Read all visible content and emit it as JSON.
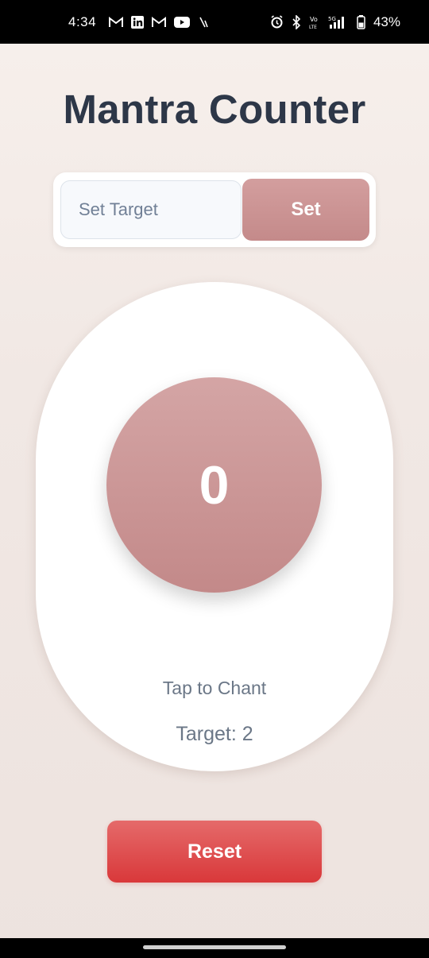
{
  "status_bar": {
    "time": "4:34",
    "battery": "43%",
    "icons": [
      "gmail-icon",
      "linkedin-icon",
      "gmail-icon",
      "youtube-icon",
      "slash-icon",
      "alarm-icon",
      "bluetooth-icon",
      "volte-icon",
      "5g-signal-icon",
      "battery-icon"
    ]
  },
  "app": {
    "title": "Mantra Counter"
  },
  "target_setter": {
    "placeholder": "Set Target",
    "value": "",
    "set_label": "Set"
  },
  "counter": {
    "count": "0",
    "tap_label": "Tap to Chant",
    "target_text": "Target: 2"
  },
  "reset_label": "Reset",
  "colors": {
    "title": "#2d3748",
    "accent": "#c98f8f",
    "reset": "#dc3c3e",
    "muted_text": "#6b7787"
  }
}
